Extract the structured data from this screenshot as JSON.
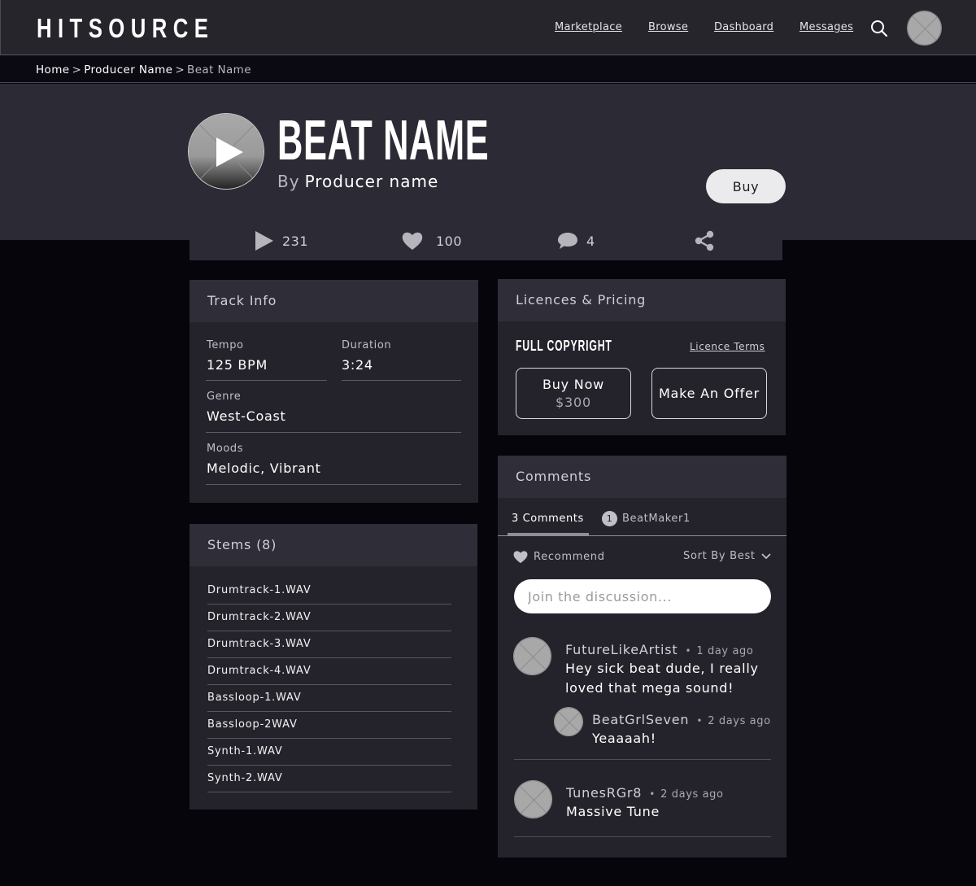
{
  "brand": {
    "logo": "HITSOURCE"
  },
  "nav": {
    "links": [
      "Marketplace",
      "Browse",
      "Dashboard",
      "Messages"
    ],
    "icons": {
      "search": "search-icon",
      "avatar": "user-avatar-placeholder"
    }
  },
  "breadcrumb": {
    "items": [
      "Home",
      "Producer Name"
    ],
    "current": "Beat Name",
    "separator": ">"
  },
  "beat": {
    "title": "BEAT NAME",
    "by_label": "By",
    "producer": "Producer name",
    "buy_label": "Buy"
  },
  "stats": {
    "plays": "231",
    "likes": "100",
    "comments": "4"
  },
  "track_info": {
    "heading": "Track Info",
    "tempo_label": "Tempo",
    "tempo": "125 BPM",
    "duration_label": "Duration",
    "duration": "3:24",
    "genre_label": "Genre",
    "genre": "West-Coast",
    "moods_label": "Moods",
    "moods": "Melodic, Vibrant"
  },
  "stems": {
    "heading": "Stems (8)",
    "items": [
      "Drumtrack-1.WAV",
      "Drumtrack-2.WAV",
      "Drumtrack-3.WAV",
      "Drumtrack-4.WAV",
      "Bassloop-1.WAV",
      "Bassloop-2WAV",
      "Synth-1.WAV",
      "Synth-2.WAV"
    ]
  },
  "licences": {
    "heading": "Licences & Pricing",
    "name": "FULL COPYRIGHT",
    "terms_label": "Licence Terms",
    "buy_now_label": "Buy Now",
    "price": "$300",
    "offer_label": "Make An Offer"
  },
  "comments": {
    "heading": "Comments",
    "tab_count": "3 Comments",
    "notif_count": "1",
    "tab_user": "BeatMaker1",
    "recommend_label": "Recommend",
    "sort_label": "Sort By Best",
    "input_placeholder": "Join the discussion...",
    "threads": [
      {
        "user": "FutureLikeArtist",
        "time": "1 day ago",
        "text": "Hey sick beat dude, I really loved that mega sound!"
      },
      {
        "user": "BeatGrlSeven",
        "time": "2 days ago",
        "text": "Yeaaaah!"
      },
      {
        "user": "TunesRGr8",
        "time": "2 days ago",
        "text": "Massive Tune"
      }
    ]
  },
  "colors": {
    "background": "#06050c",
    "panel": "#24232b",
    "panel_head": "#2e2d38",
    "hero": "#2c2b35",
    "topbar": "#25252b"
  }
}
